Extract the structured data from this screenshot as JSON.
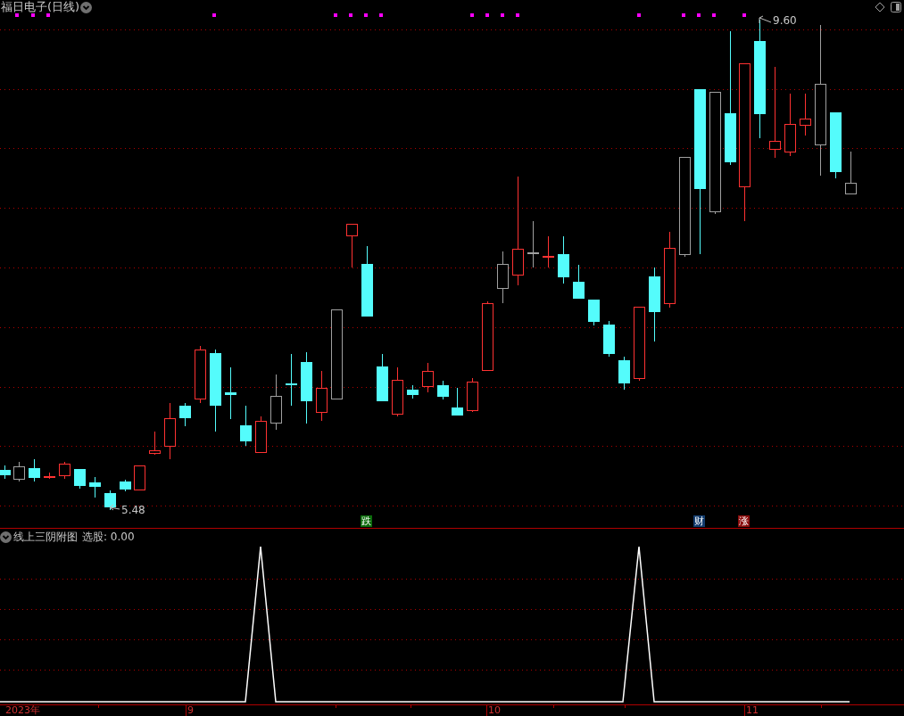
{
  "window": {
    "title": "福日电子(日线)"
  },
  "main_chart": {
    "high_label": "9.60",
    "low_label": "5.48",
    "signals": [
      {
        "text": "跌",
        "color": "#0b6b0b"
      },
      {
        "text": "财",
        "color": "#123c6e"
      },
      {
        "text": "涨",
        "color": "#8a0c0c"
      }
    ]
  },
  "indicator": {
    "title": "线上三阴附图",
    "reading": "选股: 0.00"
  },
  "x_axis": {
    "labels": [
      "2023年",
      "9",
      "10",
      "11"
    ]
  }
}
